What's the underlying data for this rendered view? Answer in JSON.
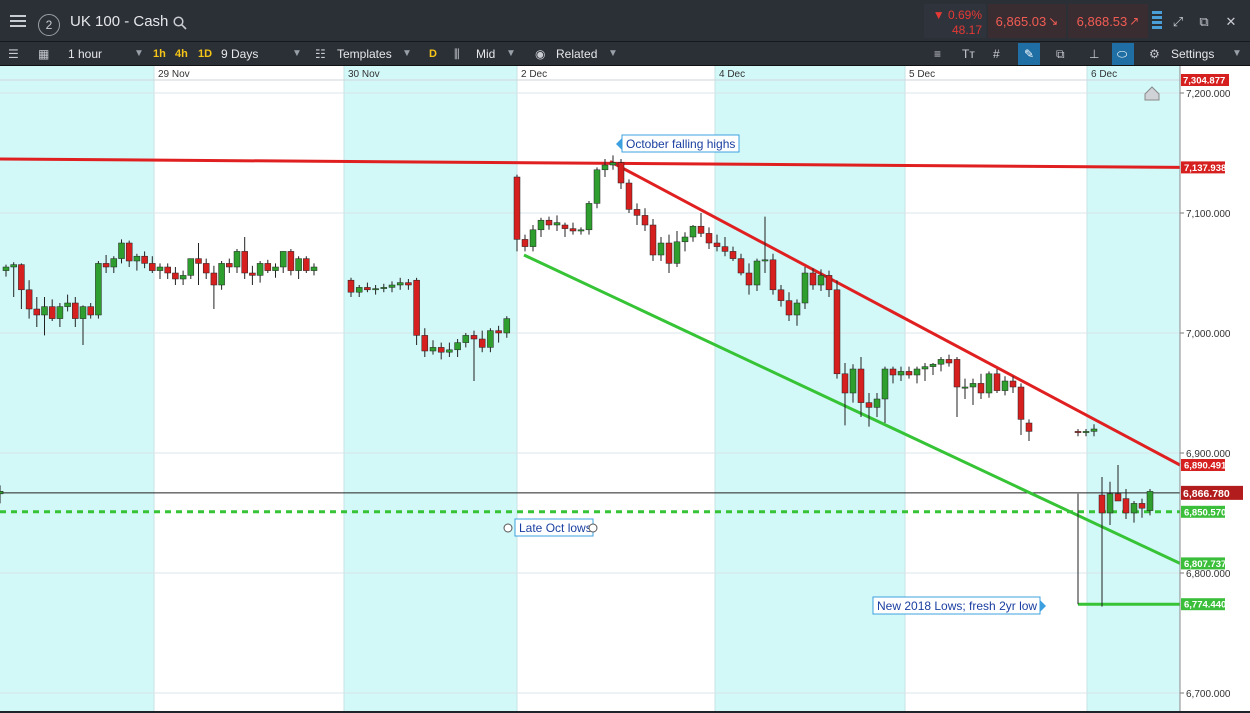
{
  "topbar": {
    "workspace_number": "2",
    "instrument": "UK 100 - Cash",
    "change_pct": "0.69%",
    "change_points": "48.17",
    "sell_price": "6,865.03",
    "buy_price": "6,868.53",
    "colors": {
      "down": "#e53935"
    }
  },
  "toolbar": {
    "interval": "1 hour",
    "quick_1h": "1h",
    "quick_4h": "4h",
    "quick_1d": "1D",
    "range": "9 Days",
    "templates": "Templates",
    "d_button": "D",
    "price_type": "Mid",
    "related": "Related",
    "settings": "Settings"
  },
  "icons": [
    "menu-icon",
    "search-icon",
    "layout-icon",
    "grid-layout-icon",
    "templates-icon",
    "candles-icon",
    "eye-icon",
    "expand-icon",
    "popout-icon",
    "close-icon",
    "text-tool-icon",
    "crosshair-icon",
    "drawing-icon",
    "copy-icon",
    "measure-icon",
    "tag-icon",
    "gear-icon"
  ],
  "chart_data": {
    "type": "candlestick",
    "instrument": "UK 100 - Cash",
    "interval": "1 hour",
    "x_date_labels": [
      "29 Nov",
      "30 Nov",
      "2 Dec",
      "4 Dec",
      "5 Dec",
      "6 Dec"
    ],
    "y_ticks": [
      "7,200.000",
      "7,100.000",
      "7,000.000",
      "6,900.000",
      "6,800.000",
      "6,700.000"
    ],
    "ylim": [
      6690,
      7305
    ],
    "grid": true,
    "y_axis_position": "right",
    "candles": [
      [
        7052,
        7057,
        7047,
        7055
      ],
      [
        7055,
        7059,
        7030,
        7057
      ],
      [
        7057,
        7058,
        7020,
        7036
      ],
      [
        7036,
        7044,
        7012,
        7020
      ],
      [
        7020,
        7030,
        7005,
        7015
      ],
      [
        7015,
        7030,
        6998,
        7022
      ],
      [
        7022,
        7028,
        7010,
        7012
      ],
      [
        7012,
        7025,
        7005,
        7022
      ],
      [
        7022,
        7032,
        7018,
        7025
      ],
      [
        7025,
        7030,
        7005,
        7012
      ],
      [
        7012,
        7023,
        6990,
        7022
      ],
      [
        7022,
        7025,
        7012,
        7015
      ],
      [
        7015,
        7060,
        7012,
        7058
      ],
      [
        7058,
        7065,
        7050,
        7055
      ],
      [
        7055,
        7064,
        7050,
        7062
      ],
      [
        7062,
        7078,
        7058,
        7075
      ],
      [
        7075,
        7077,
        7055,
        7060
      ],
      [
        7060,
        7066,
        7052,
        7064
      ],
      [
        7064,
        7068,
        7054,
        7058
      ],
      [
        7058,
        7064,
        7050,
        7052
      ],
      [
        7052,
        7058,
        7045,
        7055
      ],
      [
        7055,
        7058,
        7045,
        7050
      ],
      [
        7050,
        7055,
        7040,
        7045
      ],
      [
        7045,
        7052,
        7040,
        7048
      ],
      [
        7048,
        7062,
        7045,
        7062
      ],
      [
        7062,
        7075,
        7040,
        7058
      ],
      [
        7058,
        7062,
        7045,
        7050
      ],
      [
        7050,
        7056,
        7020,
        7040
      ],
      [
        7040,
        7060,
        7036,
        7058
      ],
      [
        7058,
        7062,
        7050,
        7055
      ],
      [
        7055,
        7070,
        7050,
        7068
      ],
      [
        7068,
        7080,
        7045,
        7050
      ],
      [
        7050,
        7056,
        7040,
        7048
      ],
      [
        7048,
        7060,
        7042,
        7058
      ],
      [
        7058,
        7061,
        7050,
        7052
      ],
      [
        7052,
        7058,
        7046,
        7055
      ],
      [
        7055,
        7068,
        7050,
        7068
      ],
      [
        7068,
        7070,
        7048,
        7052
      ],
      [
        7052,
        7064,
        7045,
        7062
      ],
      [
        7062,
        7064,
        7050,
        7052
      ],
      [
        7052,
        7058,
        7048,
        7055
      ],
      [
        7044,
        7046,
        7030,
        7034
      ],
      [
        7034,
        7040,
        7030,
        7038
      ],
      [
        7038,
        7042,
        7034,
        7036
      ],
      [
        7036,
        7040,
        7032,
        7037
      ],
      [
        7037,
        7041,
        7034,
        7038
      ],
      [
        7038,
        7043,
        7034,
        7040
      ],
      [
        7040,
        7046,
        7036,
        7042
      ],
      [
        7042,
        7045,
        7036,
        7040
      ],
      [
        7044,
        7046,
        6990,
        6998
      ],
      [
        6998,
        7004,
        6980,
        6985
      ],
      [
        6985,
        6994,
        6982,
        6988
      ],
      [
        6988,
        6992,
        6978,
        6984
      ],
      [
        6984,
        6992,
        6980,
        6986
      ],
      [
        6986,
        6995,
        6980,
        6992
      ],
      [
        6992,
        7000,
        6988,
        6998
      ],
      [
        6998,
        7002,
        6960,
        6995
      ],
      [
        6995,
        7002,
        6984,
        6988
      ],
      [
        6988,
        7004,
        6984,
        7002
      ],
      [
        7002,
        7006,
        6992,
        7000
      ],
      [
        7000,
        7014,
        6996,
        7012
      ],
      [
        7130,
        7132,
        7068,
        7078
      ],
      [
        7078,
        7082,
        7068,
        7072
      ],
      [
        7072,
        7090,
        7068,
        7086
      ],
      [
        7086,
        7096,
        7080,
        7094
      ],
      [
        7094,
        7097,
        7086,
        7090
      ],
      [
        7090,
        7098,
        7085,
        7092
      ],
      [
        7090,
        7092,
        7080,
        7087
      ],
      [
        7087,
        7092,
        7082,
        7085
      ],
      [
        7085,
        7088,
        7082,
        7086
      ],
      [
        7086,
        7110,
        7082,
        7108
      ],
      [
        7108,
        7138,
        7104,
        7136
      ],
      [
        7136,
        7145,
        7130,
        7140
      ],
      [
        7140,
        7148,
        7136,
        7142
      ],
      [
        7142,
        7145,
        7120,
        7125
      ],
      [
        7125,
        7128,
        7100,
        7103
      ],
      [
        7103,
        7108,
        7090,
        7098
      ],
      [
        7098,
        7104,
        7085,
        7090
      ],
      [
        7090,
        7095,
        7060,
        7065
      ],
      [
        7065,
        7080,
        7060,
        7075
      ],
      [
        7075,
        7082,
        7050,
        7058
      ],
      [
        7058,
        7085,
        7055,
        7076
      ],
      [
        7076,
        7084,
        7068,
        7080
      ],
      [
        7080,
        7090,
        7076,
        7089
      ],
      [
        7089,
        7100,
        7080,
        7083
      ],
      [
        7083,
        7088,
        7070,
        7075
      ],
      [
        7075,
        7082,
        7068,
        7072
      ],
      [
        7072,
        7080,
        7064,
        7068
      ],
      [
        7068,
        7072,
        7060,
        7062
      ],
      [
        7062,
        7066,
        7048,
        7050
      ],
      [
        7050,
        7058,
        7032,
        7040
      ],
      [
        7040,
        7062,
        7035,
        7060
      ],
      [
        7060,
        7097,
        7050,
        7061
      ],
      [
        7061,
        7066,
        7032,
        7036
      ],
      [
        7036,
        7040,
        7022,
        7027
      ],
      [
        7027,
        7034,
        7010,
        7015
      ],
      [
        7015,
        7028,
        7006,
        7025
      ],
      [
        7025,
        7055,
        7020,
        7050
      ],
      [
        7050,
        7054,
        7036,
        7040
      ],
      [
        7040,
        7053,
        7035,
        7048
      ],
      [
        7048,
        7052,
        7030,
        7036
      ],
      [
        7036,
        7044,
        6962,
        6966
      ],
      [
        6966,
        6975,
        6923,
        6950
      ],
      [
        6950,
        6974,
        6942,
        6970
      ],
      [
        6970,
        6980,
        6930,
        6942
      ],
      [
        6942,
        6950,
        6922,
        6938
      ],
      [
        6938,
        6950,
        6930,
        6945
      ],
      [
        6945,
        6972,
        6925,
        6970
      ],
      [
        6970,
        6972,
        6958,
        6965
      ],
      [
        6965,
        6972,
        6960,
        6968
      ],
      [
        6968,
        6972,
        6962,
        6965
      ],
      [
        6965,
        6972,
        6958,
        6970
      ],
      [
        6970,
        6975,
        6960,
        6972
      ],
      [
        6972,
        6975,
        6965,
        6974
      ],
      [
        6974,
        6980,
        6968,
        6978
      ],
      [
        6978,
        6982,
        6972,
        6975
      ],
      [
        6978,
        6980,
        6930,
        6955
      ],
      [
        6955,
        6962,
        6945,
        6955
      ],
      [
        6955,
        6962,
        6940,
        6958
      ],
      [
        6958,
        6966,
        6945,
        6950
      ],
      [
        6950,
        6968,
        6946,
        6966
      ],
      [
        6966,
        6970,
        6950,
        6952
      ],
      [
        6952,
        6964,
        6948,
        6960
      ],
      [
        6960,
        6964,
        6950,
        6955
      ],
      [
        6955,
        6958,
        6915,
        6928
      ],
      [
        6925,
        6928,
        6910,
        6918
      ],
      [
        6918,
        6920,
        6914,
        6917
      ],
      [
        6917,
        6920,
        6914,
        6918
      ],
      [
        6918,
        6924,
        6914,
        6920
      ],
      [
        6865,
        6880,
        6772,
        6850
      ],
      [
        6850,
        6876,
        6840,
        6866
      ],
      [
        6866,
        6890,
        6860,
        6860
      ],
      [
        6862,
        6870,
        6845,
        6850
      ],
      [
        6850,
        6860,
        6842,
        6858
      ],
      [
        6858,
        6862,
        6846,
        6854
      ],
      [
        6852,
        6870,
        6848,
        6868
      ],
      [
        6868,
        6873,
        6860,
        6866
      ],
      [
        6866,
        6870,
        6858,
        6868
      ]
    ],
    "candle_colors": {
      "up": "#2e9e2e",
      "down": "#d62020"
    },
    "lines": [
      {
        "label": "7,137.938",
        "color": "#e02020",
        "points": [
          [
            "27 Nov",
            7145
          ],
          [
            "6 Dec",
            7138
          ]
        ]
      },
      {
        "label": "6,890.491",
        "color": "#e02020",
        "points": [
          [
            "3 Dec",
            7143
          ],
          [
            "6 Dec",
            6890
          ]
        ]
      },
      {
        "label": "6,807.737",
        "color": "#36c436",
        "points": [
          [
            "2 Dec",
            7065
          ],
          [
            "6 Dec",
            6808
          ]
        ]
      },
      {
        "label": "6,850.570",
        "color": "#36c436",
        "style": "dashed",
        "points": [
          [
            "27 Nov",
            6851
          ],
          [
            "6 Dec",
            6851
          ]
        ]
      },
      {
        "label": "6,774.440",
        "color": "#36c436",
        "points": [
          [
            "6 Dec",
            6774
          ],
          [
            "6 Dec",
            6774
          ]
        ]
      }
    ],
    "current_price": {
      "label": "6,866.780",
      "value": 6866.78
    },
    "top_tag": {
      "label": "7,304.877",
      "value": 7304.877
    },
    "annotations": [
      "October falling highs",
      "Late Oct lows",
      "New 2018 Lows; fresh 2yr low"
    ]
  }
}
